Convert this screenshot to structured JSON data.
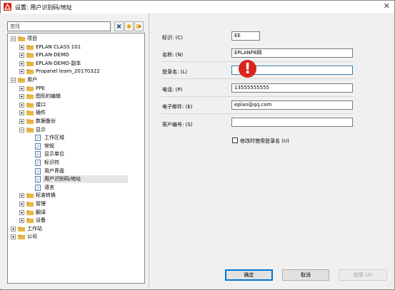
{
  "window": {
    "title": "设置: 用户识别码/地址",
    "close_glyph": "✕"
  },
  "search": {
    "placeholder": "查找"
  },
  "tree": [
    {
      "label": "项目",
      "indent": 0,
      "expander": "minus",
      "icon": "folder",
      "selected": false
    },
    {
      "label": "EPLAN CLASS 101",
      "indent": 1,
      "expander": "plus",
      "icon": "folder",
      "selected": false
    },
    {
      "label": "EPLAN-DEMO",
      "indent": 1,
      "expander": "plus",
      "icon": "folder",
      "selected": false
    },
    {
      "label": "EPLAN-DEMO-副本",
      "indent": 1,
      "expander": "plus",
      "icon": "folder",
      "selected": false
    },
    {
      "label": "Propanel learn_20170322",
      "indent": 1,
      "expander": "plus",
      "icon": "folder",
      "selected": false
    },
    {
      "label": "用户",
      "indent": 0,
      "expander": "minus",
      "icon": "folder",
      "selected": false
    },
    {
      "label": "PPE",
      "indent": 1,
      "expander": "plus",
      "icon": "folder",
      "selected": false
    },
    {
      "label": "图形的编辑",
      "indent": 1,
      "expander": "plus",
      "icon": "folder",
      "selected": false
    },
    {
      "label": "接口",
      "indent": 1,
      "expander": "plus",
      "icon": "folder",
      "selected": false
    },
    {
      "label": "插件",
      "indent": 1,
      "expander": "plus",
      "icon": "folder",
      "selected": false
    },
    {
      "label": "数据备份",
      "indent": 1,
      "expander": "plus",
      "icon": "folder",
      "selected": false
    },
    {
      "label": "显示",
      "indent": 1,
      "expander": "minus",
      "icon": "folder",
      "selected": false
    },
    {
      "label": "工作区域",
      "indent": 2,
      "expander": "none",
      "icon": "doc",
      "selected": false
    },
    {
      "label": "常规",
      "indent": 2,
      "expander": "none",
      "icon": "doc",
      "selected": false
    },
    {
      "label": "显示单位",
      "indent": 2,
      "expander": "none",
      "icon": "doc",
      "selected": false
    },
    {
      "label": "标识符",
      "indent": 2,
      "expander": "none",
      "icon": "doc",
      "selected": false
    },
    {
      "label": "用户界面",
      "indent": 2,
      "expander": "none",
      "icon": "doc",
      "selected": false
    },
    {
      "label": "用户识别码/地址",
      "indent": 2,
      "expander": "none",
      "icon": "doc",
      "selected": true
    },
    {
      "label": "语言",
      "indent": 2,
      "expander": "none",
      "icon": "doc",
      "selected": false
    },
    {
      "label": "标准转换",
      "indent": 1,
      "expander": "plus",
      "icon": "folder",
      "selected": false
    },
    {
      "label": "管理",
      "indent": 1,
      "expander": "plus",
      "icon": "folder",
      "selected": false
    },
    {
      "label": "翻译",
      "indent": 1,
      "expander": "plus",
      "icon": "folder",
      "selected": false
    },
    {
      "label": "设备",
      "indent": 1,
      "expander": "plus",
      "icon": "folder",
      "selected": false
    },
    {
      "label": "工作站",
      "indent": 0,
      "expander": "plus",
      "icon": "folder",
      "selected": false
    },
    {
      "label": "公司",
      "indent": 0,
      "expander": "plus",
      "icon": "folder",
      "selected": false
    }
  ],
  "form": {
    "identifier_label": "标识: (C)",
    "identifier_value": "EE",
    "name_label": "名称: (N)",
    "name_value": "EPLANP8网",
    "login_label": "登录名: (L)",
    "login_value": "",
    "phone_label": "电话: (P)",
    "phone_value": "13555555555",
    "email_label": "电子邮件: (E)",
    "email_value": "eplan@qq.com",
    "customer_label": "客户编号: (S)",
    "customer_value": "",
    "checkbox_label": "修改时使用登录名 (U)",
    "checkbox_checked": false,
    "warning_glyph": "!"
  },
  "buttons": {
    "ok": "确定",
    "cancel": "取消",
    "apply": "应用 (A)"
  },
  "colors": {
    "accent": "#0078d7",
    "warning": "#d9261c",
    "folder": "#e8b84a"
  }
}
